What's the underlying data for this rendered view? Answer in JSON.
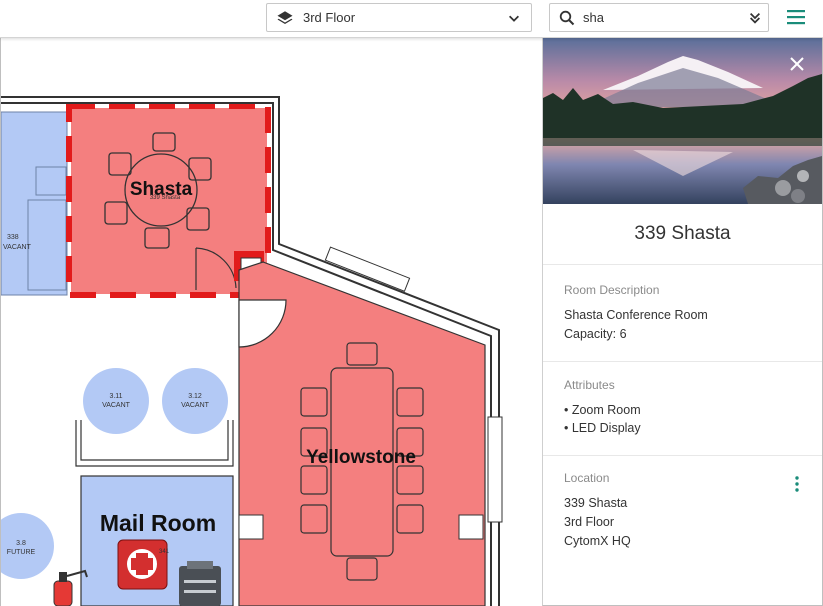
{
  "toolbar": {
    "floor_select": {
      "value": "3rd Floor",
      "icon": "layers-icon"
    },
    "search": {
      "value": "sha",
      "icon": "search-icon"
    },
    "menu_icon": "hamburger-menu-icon"
  },
  "map": {
    "rooms": {
      "shasta": {
        "label": "Shasta",
        "sublabel": "339 Shasta"
      },
      "yellowstone": {
        "label": "Yellowstone"
      },
      "mail_room": {
        "label": "Mail Room"
      },
      "room_338": {
        "number": "338",
        "status": "VACANT"
      },
      "room_311": {
        "number": "3.11",
        "status": "VACANT"
      },
      "room_312": {
        "number": "3.12",
        "status": "VACANT"
      },
      "room_38": {
        "number": "3.8",
        "status": "FUTURE"
      },
      "first_aid_code": "341"
    },
    "colors": {
      "selected_room": "#f47f7f",
      "highlight_border": "#e21b1b",
      "vacant_room": "#b3c9f5",
      "wall": "#333333"
    }
  },
  "panel": {
    "title": "339 Shasta",
    "sections": {
      "description": {
        "label": "Room Description",
        "lines": [
          "Shasta Conference Room",
          "Capacity: 6"
        ]
      },
      "attributes": {
        "label": "Attributes",
        "items": [
          "• Zoom Room",
          "• LED Display"
        ]
      },
      "location": {
        "label": "Location",
        "lines": [
          "339 Shasta",
          "3rd Floor",
          "CytomX HQ"
        ]
      }
    }
  },
  "accent_color": "#1a8c7a"
}
